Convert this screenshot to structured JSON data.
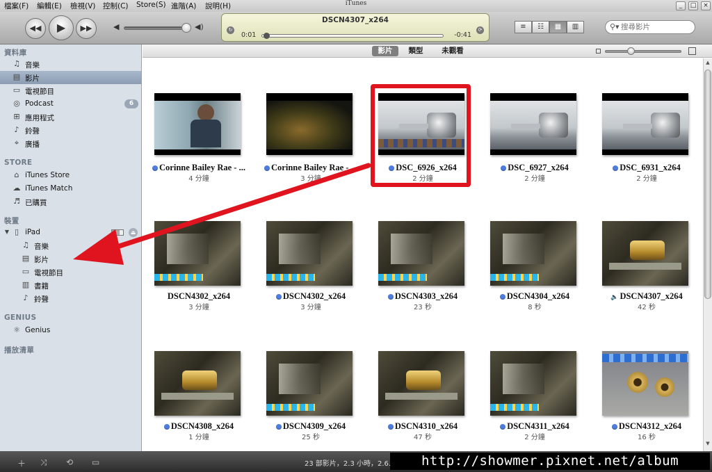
{
  "window": {
    "title": "iTunes",
    "menu": [
      "檔案(F)",
      "編輯(E)",
      "檢視(V)",
      "控制(C)",
      "Store(S)",
      "進階(A)",
      "說明(H)"
    ],
    "controls": [
      "_",
      "□",
      "×"
    ]
  },
  "player": {
    "now_playing": "DSCN4307_x264",
    "elapsed": "0:01",
    "remaining": "-0:41",
    "progress": 0.02,
    "volume": 0.9
  },
  "search": {
    "placeholder": "搜尋影片"
  },
  "view_modes": [
    "list-view",
    "album-list-view",
    "grid-view",
    "coverflow-view"
  ],
  "sidebar": {
    "library_header": "資料庫",
    "library": [
      {
        "label": "音樂",
        "icon": "music-note-icon"
      },
      {
        "label": "影片",
        "icon": "film-icon",
        "selected": true
      },
      {
        "label": "電視節目",
        "icon": "tv-icon"
      },
      {
        "label": "Podcast",
        "icon": "podcast-icon",
        "badge": "6"
      },
      {
        "label": "應用程式",
        "icon": "apps-icon"
      },
      {
        "label": "鈴聲",
        "icon": "bell-icon"
      },
      {
        "label": "廣播",
        "icon": "radio-tower-icon"
      }
    ],
    "store_header": "STORE",
    "store": [
      {
        "label": "iTunes Store",
        "icon": "store-house-icon"
      },
      {
        "label": "iTunes Match",
        "icon": "cloud-icon"
      },
      {
        "label": "已購買",
        "icon": "purchased-icon"
      }
    ],
    "devices_header": "裝置",
    "device_name": "iPad",
    "device_items": [
      {
        "label": "音樂",
        "icon": "music-note-icon"
      },
      {
        "label": "影片",
        "icon": "film-icon"
      },
      {
        "label": "電視節目",
        "icon": "tv-icon"
      },
      {
        "label": "書籍",
        "icon": "book-icon"
      },
      {
        "label": "鈴聲",
        "icon": "bell-icon"
      }
    ],
    "genius_header": "GENIUS",
    "genius": [
      {
        "label": "Genius",
        "icon": "genius-atom-icon"
      }
    ],
    "playlists_header": "播放清單"
  },
  "content_tabs": [
    {
      "label": "影片",
      "active": true
    },
    {
      "label": "類型",
      "active": false
    },
    {
      "label": "未觀看",
      "active": false
    }
  ],
  "videos": [
    {
      "title": "Corinne Bailey Rae - ...",
      "duration": "4 分鐘",
      "new": true,
      "kind": "film-room"
    },
    {
      "title": "Corinne Bailey Rae - ...",
      "duration": "3 分鐘",
      "new": true,
      "kind": "film-forest"
    },
    {
      "title": "DSC_6926_x264",
      "duration": "2 分鐘",
      "new": true,
      "kind": "lathe",
      "highlighted": true
    },
    {
      "title": "DSC_6927_x264",
      "duration": "2 分鐘",
      "new": true,
      "kind": "lathe"
    },
    {
      "title": "DSC_6931_x264",
      "duration": "2 分鐘",
      "new": true,
      "kind": "lathe"
    },
    {
      "title": "DSCN4302_x264",
      "duration": "3 分鐘",
      "new": false,
      "kind": "machine"
    },
    {
      "title": "DSCN4302_x264",
      "duration": "3 分鐘",
      "new": true,
      "kind": "machine"
    },
    {
      "title": "DSCN4303_x264",
      "duration": "23 秒",
      "new": true,
      "kind": "machine"
    },
    {
      "title": "DSCN4304_x264",
      "duration": "8 秒",
      "new": true,
      "kind": "machine"
    },
    {
      "title": "DSCN4307_x264",
      "duration": "42 秒",
      "new": false,
      "playing": true,
      "kind": "machine-brass"
    },
    {
      "title": "DSCN4308_x264",
      "duration": "1 分鐘",
      "new": true,
      "kind": "machine-brass"
    },
    {
      "title": "DSCN4309_x264",
      "duration": "25 秒",
      "new": true,
      "kind": "machine"
    },
    {
      "title": "DSCN4310_x264",
      "duration": "47 秒",
      "new": true,
      "kind": "machine-brass"
    },
    {
      "title": "DSCN4311_x264",
      "duration": "2 分鐘",
      "new": true,
      "kind": "machine"
    },
    {
      "title": "DSCN4312_x264",
      "duration": "16 秒",
      "new": true,
      "kind": "brass-parts"
    }
  ],
  "status": {
    "summary": "23 部影片，2.3 小時，2.6..."
  },
  "watermark": "http://showmer.pixnet.net/album",
  "colors": {
    "annotation": "#e0141e",
    "new_dot": "#4d7dde",
    "selection": "#9aaabf"
  }
}
